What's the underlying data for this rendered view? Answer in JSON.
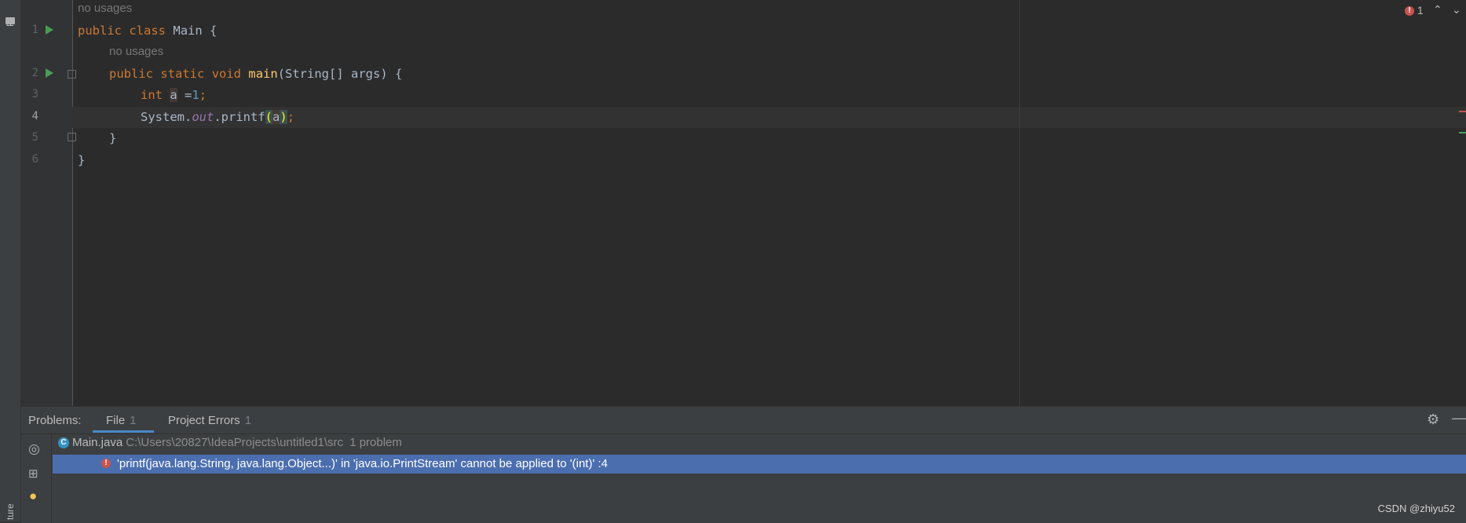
{
  "sidebar": {
    "project_label": "Pr",
    "structure_label": "ture"
  },
  "editor": {
    "inlay_hint_class": "no usages",
    "inlay_hint_method": "no usages",
    "line_numbers": [
      "1",
      "2",
      "3",
      "4",
      "5",
      "6"
    ],
    "lines": {
      "l1": {
        "kw1": "public",
        "kw2": "class",
        "name": "Main",
        "brace": "{"
      },
      "l2": {
        "kw1": "public",
        "kw2": "static",
        "kw3": "void",
        "fn": "main",
        "params": "(String[] args) {"
      },
      "l3": {
        "kw": "int",
        "var": "a",
        "eq": " =",
        "num": "1",
        "semi": ";"
      },
      "l4": {
        "recv": "System.",
        "fld": "out",
        "call": ".printf",
        "open": "(",
        "arg": "a",
        "close": ")",
        "semi": ";"
      },
      "l5": {
        "text": "}"
      },
      "l6": {
        "text": "}"
      }
    },
    "error_count": "1",
    "stripe_colors": {
      "error": "#c75450",
      "ok": "#499c54"
    }
  },
  "problems": {
    "title": "Problems:",
    "tabs": [
      {
        "label": "File",
        "count": "1"
      },
      {
        "label": "Project Errors",
        "count": "1"
      }
    ],
    "file_row": {
      "filename": "Main.java",
      "path": "C:\\Users\\20827\\IdeaProjects\\untitled1\\src",
      "summary": "1 problem"
    },
    "error_row": {
      "message": "'printf(java.lang.String, java.lang.Object...)' in 'java.io.PrintStream' cannot be applied to '(int)' :4"
    }
  },
  "watermark": "CSDN @zhiyu52",
  "colors": {
    "accent": "#4a88c7",
    "selection": "#4b6eaf",
    "error": "#c75450",
    "run": "#499c54"
  }
}
